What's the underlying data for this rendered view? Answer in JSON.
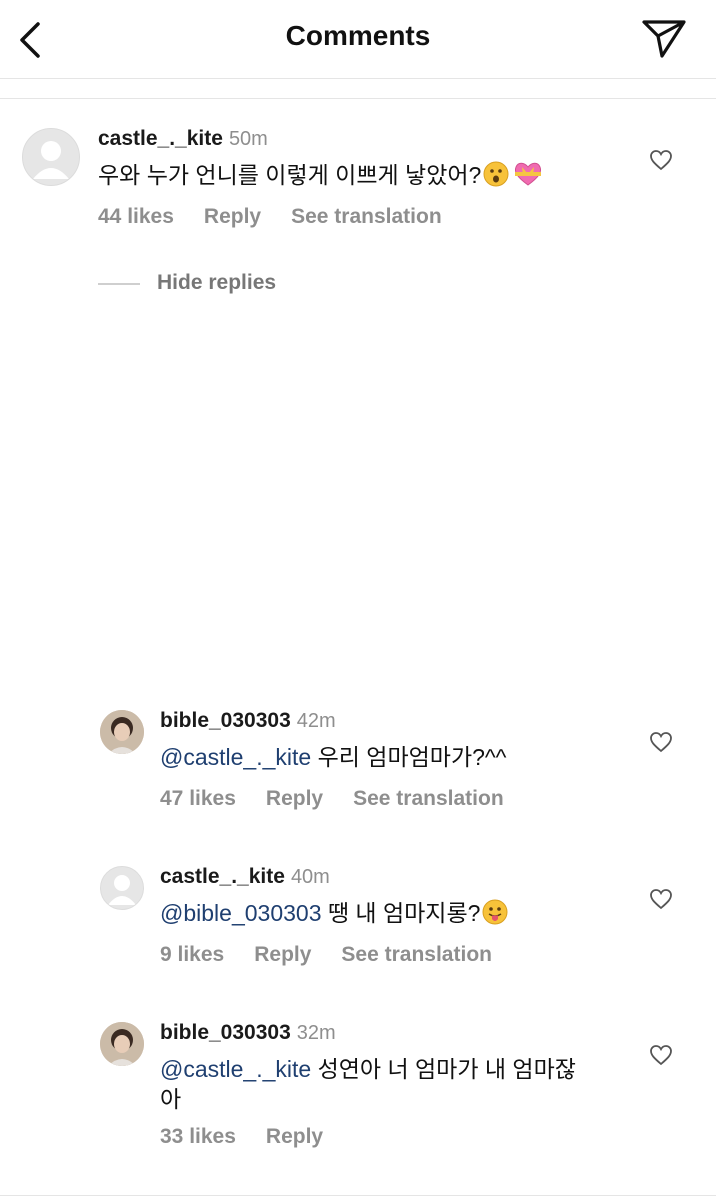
{
  "header": {
    "title": "Comments"
  },
  "hide_replies_label": "Hide replies",
  "comments": [
    {
      "username": "castle_._kite",
      "time": "50m",
      "text": "우와 누가 언니를 이렇게 이쁘게 낳았어?",
      "likes": "44 likes",
      "reply_label": "Reply",
      "translation_label": "See translation",
      "emojis": [
        "hushed-face-emoji",
        "heart-with-ribbon-emoji"
      ]
    },
    {
      "username": "bible_030303",
      "time": "42m",
      "mention": "@castle_._kite",
      "text": " 우리 엄마엄마가?^^",
      "likes": "47 likes",
      "reply_label": "Reply",
      "translation_label": "See translation"
    },
    {
      "username": "castle_._kite",
      "time": "40m",
      "mention": "@bible_030303",
      "text": " 땡 내 엄마지롱?",
      "likes": "9 likes",
      "reply_label": "Reply",
      "translation_label": "See translation",
      "emojis": [
        "tongue-out-face-emoji"
      ]
    },
    {
      "username": "bible_030303",
      "time": "32m",
      "mention": "@castle_._kite",
      "text": " 성연아 너 엄마가 내 엄마잖",
      "text_line2": "아",
      "likes": "33 likes",
      "reply_label": "Reply"
    }
  ]
}
